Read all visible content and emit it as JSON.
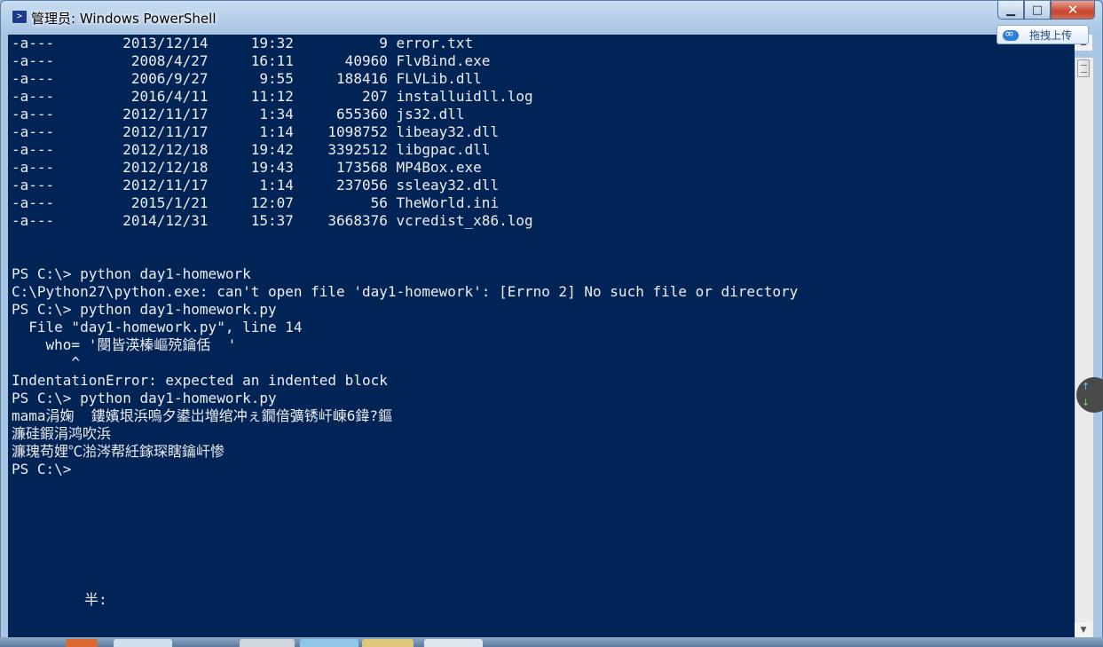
{
  "window": {
    "title": "管理员: Windows PowerShell",
    "icon": "powershell-icon",
    "buttons": {
      "minimize": "▁",
      "maximize": "□",
      "close": "✕"
    }
  },
  "upload_badge": {
    "label": "拖拽上传",
    "icon": "baidu-cloud-icon"
  },
  "console": {
    "lines": [
      "-a---        2013/12/14     19:32          9 error.txt",
      "-a---         2008/4/27     16:11      40960 FlvBind.exe",
      "-a---         2006/9/27      9:55     188416 FLVLib.dll",
      "-a---         2016/4/11     11:12        207 installuidll.log",
      "-a---        2012/11/17      1:34     655360 js32.dll",
      "-a---        2012/11/17      1:14    1098752 libeay32.dll",
      "-a---        2012/12/18     19:42    3392512 libgpac.dll",
      "-a---        2012/12/18     19:43     173568 MP4Box.exe",
      "-a---        2012/11/17      1:14     237056 ssleay32.dll",
      "-a---         2015/1/21     12:07         56 TheWorld.ini",
      "-a---        2014/12/31     15:37    3668376 vcredist_x86.log",
      "",
      "",
      "PS C:\\> python day1-homework",
      "C:\\Python27\\python.exe: can't open file 'day1-homework': [Errno 2] No such file or directory",
      "PS C:\\> python day1-homework.py",
      "  File \"day1-homework.py\", line 14",
      "    who= '閿皆渶榛嶇殑鑰佸  '",
      "       ^",
      "IndentationError: expected an indented block",
      "PS C:\\> python day1-homework.py",
      "mama涓婅  鏤嬪垠浜嗚夕鍙岀増绾冲ぇ鐗偣彍锈屽崠6鍏?鏂",
      "濂硅鍜涓鸿吹浜",
      "濂瑰苟娌℃湁涔帮紝鎵琛瞎鑰屽惨",
      "PS C:\\>"
    ],
    "ime_hint": "半:"
  },
  "scrollbar": {
    "up": "▲",
    "down": "▼"
  },
  "side_widget": {
    "up": "↑",
    "down": "↓"
  },
  "colors": {
    "console_bg": "#012456",
    "console_fg": "#eeedf0"
  }
}
